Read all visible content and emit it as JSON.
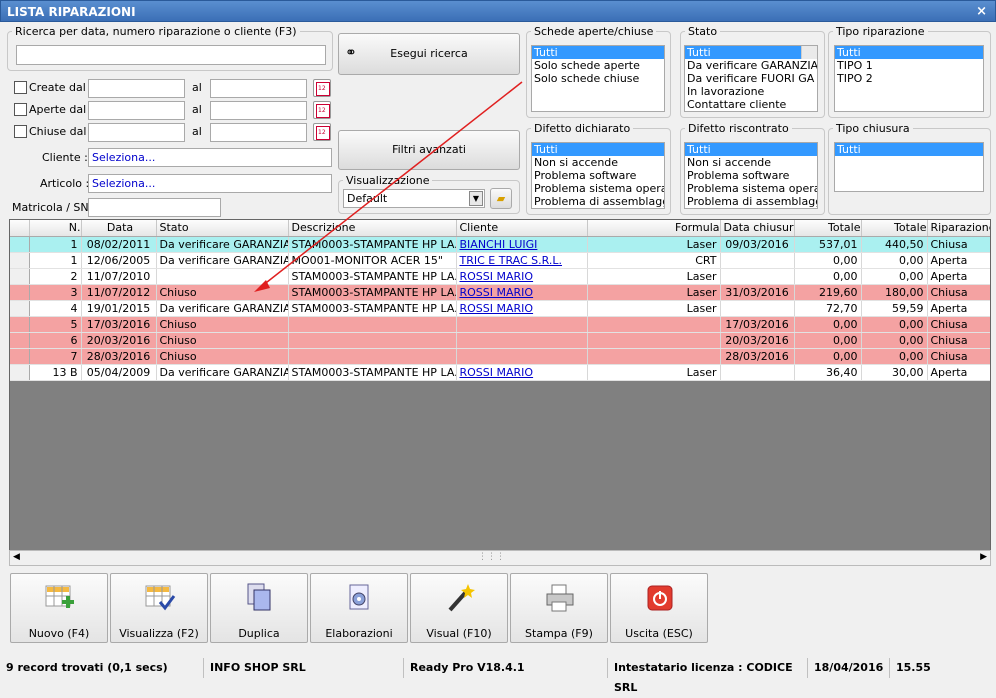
{
  "window": {
    "title": "LISTA RIPARAZIONI",
    "close": "×"
  },
  "search": {
    "legend": "Ricerca per data, numero riparazione o cliente (F3)",
    "value": "",
    "run_label": "Esegui ricerca",
    "advanced_label": "Filtri avanzati"
  },
  "dates": {
    "created_label": "Create dal",
    "open_label": "Aperte dal",
    "closed_label": "Chiuse dal",
    "al": "al"
  },
  "client": {
    "label": "Cliente :",
    "value": "Seleziona..."
  },
  "article": {
    "label": "Articolo :",
    "value": "Seleziona..."
  },
  "serial": {
    "label": "Matricola / SN:",
    "value": ""
  },
  "view": {
    "legend": "Visualizzazione",
    "value": "Default"
  },
  "schede": {
    "legend": "Schede aperte/chiuse",
    "items": [
      "Tutti",
      "Solo schede aperte",
      "Solo schede chiuse"
    ]
  },
  "stato": {
    "legend": "Stato",
    "items": [
      "Tutti",
      "Da verificare GARANZIA",
      "Da verificare FUORI GA",
      "In lavorazione",
      "Contattare cliente"
    ]
  },
  "tipo": {
    "legend": "Tipo riparazione",
    "items": [
      "Tutti",
      "TIPO 1",
      "TIPO 2"
    ]
  },
  "difetto_dich": {
    "legend": "Difetto dichiarato",
    "items": [
      "Tutti",
      "Non si accende",
      "Problema software",
      "Problema sistema operativo",
      "Problema di assemblaggio"
    ]
  },
  "difetto_risc": {
    "legend": "Difetto riscontrato",
    "items": [
      "Tutti",
      "Non si accende",
      "Problema software",
      "Problema sistema operativo",
      "Problema di assemblaggio"
    ]
  },
  "tipo_chiusura": {
    "legend": "Tipo chiusura",
    "items": [
      "Tutti"
    ]
  },
  "table": {
    "headers": [
      "N.",
      "Data",
      "Stato",
      "Descrizione",
      "Cliente",
      "Formula",
      "Data chiusura",
      "Totale",
      "Totale",
      "Riparazione"
    ],
    "rows": [
      {
        "n": "1",
        "data": "08/02/2011",
        "stato": "Da verificare GARANZIA",
        "desc": "STAM0003-STAMPANTE HP LA...",
        "cliente": "BIANCHI LUIGI",
        "formula": "Laser",
        "chiusura": "09/03/2016",
        "tot1": "537,01",
        "tot2": "440,50",
        "rip": "Chiusa",
        "style": "sel"
      },
      {
        "n": "1",
        "data": "12/06/2005",
        "stato": "Da verificare GARANZIA",
        "desc": "MO001-MONITOR ACER 15\"",
        "cliente": "TRIC E TRAC S.R.L.",
        "formula": "CRT",
        "chiusura": "",
        "tot1": "0,00",
        "tot2": "0,00",
        "rip": "Aperta",
        "style": ""
      },
      {
        "n": "2",
        "data": "11/07/2010",
        "stato": "",
        "desc": "STAM0003-STAMPANTE HP LA...",
        "cliente": "ROSSI MARIO",
        "formula": "Laser",
        "chiusura": "",
        "tot1": "0,00",
        "tot2": "0,00",
        "rip": "Aperta",
        "style": ""
      },
      {
        "n": "3",
        "data": "11/07/2012",
        "stato": "Chiuso",
        "desc": "STAM0003-STAMPANTE HP LA...",
        "cliente": "ROSSI MARIO",
        "formula": "Laser",
        "chiusura": "31/03/2016",
        "tot1": "219,60",
        "tot2": "180,00",
        "rip": "Chiusa",
        "style": "red"
      },
      {
        "n": "4",
        "data": "19/01/2015",
        "stato": "Da verificare GARANZIA",
        "desc": "STAM0003-STAMPANTE HP LA...",
        "cliente": "ROSSI MARIO",
        "formula": "Laser",
        "chiusura": "",
        "tot1": "72,70",
        "tot2": "59,59",
        "rip": "Aperta",
        "style": ""
      },
      {
        "n": "5",
        "data": "17/03/2016",
        "stato": "Chiuso",
        "desc": "",
        "cliente": "",
        "formula": "",
        "chiusura": "17/03/2016",
        "tot1": "0,00",
        "tot2": "0,00",
        "rip": "Chiusa",
        "style": "red"
      },
      {
        "n": "6",
        "data": "20/03/2016",
        "stato": "Chiuso",
        "desc": "",
        "cliente": "",
        "formula": "",
        "chiusura": "20/03/2016",
        "tot1": "0,00",
        "tot2": "0,00",
        "rip": "Chiusa",
        "style": "red"
      },
      {
        "n": "7",
        "data": "28/03/2016",
        "stato": "Chiuso",
        "desc": "",
        "cliente": "",
        "formula": "",
        "chiusura": "28/03/2016",
        "tot1": "0,00",
        "tot2": "0,00",
        "rip": "Chiusa",
        "style": "red"
      },
      {
        "n": "13 B",
        "data": "05/04/2009",
        "stato": "Da verificare GARANZIA",
        "desc": "STAM0003-STAMPANTE HP LA...",
        "cliente": "ROSSI MARIO",
        "formula": "Laser",
        "chiusura": "",
        "tot1": "36,40",
        "tot2": "30,00",
        "rip": "Aperta",
        "style": ""
      }
    ]
  },
  "toolbar": [
    {
      "label": "Nuovo (F4)",
      "icon": "grid-add-icon"
    },
    {
      "label": "Visualizza (F2)",
      "icon": "grid-check-icon"
    },
    {
      "label": "Duplica",
      "icon": "duplicate-icon"
    },
    {
      "label": "Elaborazioni",
      "icon": "gear-document-icon"
    },
    {
      "label": "Visual (F10)",
      "icon": "magic-wand-icon"
    },
    {
      "label": "Stampa (F9)",
      "icon": "printer-icon"
    },
    {
      "label": "Uscita (ESC)",
      "icon": "power-icon"
    }
  ],
  "status": {
    "records": "9 record trovati (0,1 secs)",
    "company": "INFO SHOP SRL",
    "version": "Ready Pro V18.4.1",
    "license": "Intestatario licenza : CODICE SRL",
    "date": "18/04/2016",
    "time": "15.55"
  },
  "colors": {
    "title": "#3b6fb6",
    "selected_row": "#aaf0f0",
    "closed_row": "#f4a2a2",
    "list_selection": "#3399ff",
    "arrow": "#e02020"
  }
}
